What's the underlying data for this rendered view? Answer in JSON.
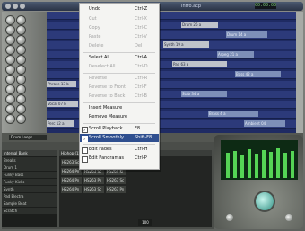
{
  "window": {
    "title": "Intro.acp",
    "time": "00:00:00"
  },
  "tracks": {
    "clips": [
      "Drum 26 a",
      "Drum 14 a",
      "Synth 19 a",
      "Arpeg 21 a",
      "Pad 63 a",
      "Bass 42 a",
      "Phrase 13 b",
      "Stab 34 a",
      "Vocal 07 b",
      "Brass 4 a",
      "Perc 12 a",
      "Ambient 04"
    ]
  },
  "lower": {
    "drum_loops_label": "Drum Loops",
    "internal_bank_label": "Internal Bank",
    "loops_header": "Hiphop (120-137 BPM)",
    "bank_rows": [
      "Breaks",
      "Drum 1",
      "Funky Bass",
      "Funky Kicks",
      "Synth",
      "Pad Electra",
      "Sample Beat",
      "Scratch"
    ],
    "cells": [
      "HS263 Sc",
      "HS263 Pn",
      "HS263 Sc",
      "HS264 Pn",
      "HS263 Sc",
      "HS264 Ki",
      "HS264 Pn",
      "HS263 Pn",
      "HS263 Sc",
      "HS264 Pn",
      "HS263 Sc",
      "HS263 Pn"
    ],
    "zoom": "100"
  },
  "menu": {
    "items": [
      {
        "label": "Undo",
        "shortcut": "Ctrl-Z",
        "enabled": true
      },
      {
        "label": "Cut",
        "shortcut": "Ctrl-X",
        "enabled": false
      },
      {
        "label": "Copy",
        "shortcut": "Ctrl-C",
        "enabled": false
      },
      {
        "label": "Paste",
        "shortcut": "Ctrl-V",
        "enabled": false
      },
      {
        "label": "Delete",
        "shortcut": "Del",
        "enabled": false
      },
      {
        "label": "Select All",
        "shortcut": "Ctrl-A",
        "enabled": true
      },
      {
        "label": "Deselect All",
        "shortcut": "Ctrl-D",
        "enabled": false
      },
      {
        "label": "Reverse",
        "shortcut": "Ctrl-R",
        "enabled": false
      },
      {
        "label": "Reverse to Front",
        "shortcut": "Ctrl-F",
        "enabled": false
      },
      {
        "label": "Reverse to Back",
        "shortcut": "Ctrl-B",
        "enabled": false
      },
      {
        "label": "Insert Measure",
        "shortcut": "",
        "enabled": true
      },
      {
        "label": "Remove Measure",
        "shortcut": "",
        "enabled": true
      },
      {
        "label": "Scroll Playback",
        "shortcut": "F8",
        "enabled": true,
        "checked": true
      },
      {
        "label": "Scroll Smoothly",
        "shortcut": "Shift-F8",
        "enabled": true,
        "checked": true,
        "highlighted": true
      },
      {
        "label": "Edit Fades",
        "shortcut": "Ctrl-H",
        "enabled": true,
        "checked": false
      },
      {
        "label": "Edit Panoramas",
        "shortcut": "Ctrl-P",
        "enabled": true,
        "checked": false
      }
    ]
  },
  "colors": {
    "menu_highlight": "#2f4f8f",
    "track_bg": "#1f2b63",
    "meter": "#55d455"
  }
}
